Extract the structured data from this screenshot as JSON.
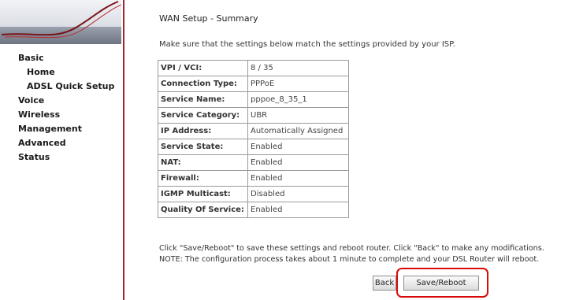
{
  "sidebar": {
    "items": [
      {
        "label": "Basic"
      },
      {
        "label": "Home"
      },
      {
        "label": "ADSL Quick Setup"
      },
      {
        "label": "Voice"
      },
      {
        "label": "Wireless"
      },
      {
        "label": "Management"
      },
      {
        "label": "Advanced"
      },
      {
        "label": "Status"
      }
    ]
  },
  "main": {
    "title": "WAN Setup - Summary",
    "intro": "Make sure that the settings below match the settings provided by your ISP.",
    "rows": [
      {
        "key": "VPI / VCI:",
        "value": "8 / 35"
      },
      {
        "key": "Connection Type:",
        "value": "PPPoE"
      },
      {
        "key": "Service Name:",
        "value": "pppoe_8_35_1"
      },
      {
        "key": "Service Category:",
        "value": "UBR"
      },
      {
        "key": "IP Address:",
        "value": "Automatically Assigned"
      },
      {
        "key": "Service State:",
        "value": "Enabled"
      },
      {
        "key": "NAT:",
        "value": "Enabled"
      },
      {
        "key": "Firewall:",
        "value": "Enabled"
      },
      {
        "key": "IGMP Multicast:",
        "value": "Disabled"
      },
      {
        "key": "Quality Of Service:",
        "value": "Enabled"
      }
    ],
    "note1": "Click \"Save/Reboot\" to save these settings and reboot router. Click \"Back\" to make any modifications.",
    "note2": "NOTE: The configuration process takes about 1 minute to complete and your DSL Router will reboot.",
    "back_label": "Back",
    "save_label": "Save/Reboot"
  },
  "colors": {
    "sidebar_border": "#a3252c",
    "highlight": "#d90a0a"
  }
}
